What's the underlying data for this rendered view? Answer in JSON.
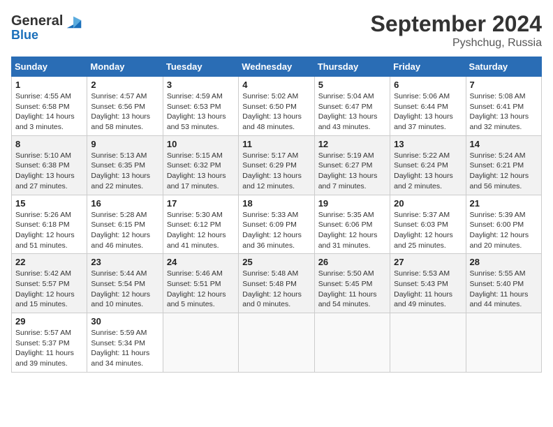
{
  "header": {
    "logo": {
      "general": "General",
      "blue": "Blue"
    },
    "title": "September 2024",
    "location": "Pyshchug, Russia"
  },
  "calendar": {
    "days_of_week": [
      "Sunday",
      "Monday",
      "Tuesday",
      "Wednesday",
      "Thursday",
      "Friday",
      "Saturday"
    ],
    "weeks": [
      [
        {
          "day": "1",
          "sunrise": "4:55 AM",
          "sunset": "6:58 PM",
          "daylight": "14 hours and 3 minutes."
        },
        {
          "day": "2",
          "sunrise": "4:57 AM",
          "sunset": "6:56 PM",
          "daylight": "13 hours and 58 minutes."
        },
        {
          "day": "3",
          "sunrise": "4:59 AM",
          "sunset": "6:53 PM",
          "daylight": "13 hours and 53 minutes."
        },
        {
          "day": "4",
          "sunrise": "5:02 AM",
          "sunset": "6:50 PM",
          "daylight": "13 hours and 48 minutes."
        },
        {
          "day": "5",
          "sunrise": "5:04 AM",
          "sunset": "6:47 PM",
          "daylight": "13 hours and 43 minutes."
        },
        {
          "day": "6",
          "sunrise": "5:06 AM",
          "sunset": "6:44 PM",
          "daylight": "13 hours and 37 minutes."
        },
        {
          "day": "7",
          "sunrise": "5:08 AM",
          "sunset": "6:41 PM",
          "daylight": "13 hours and 32 minutes."
        }
      ],
      [
        {
          "day": "8",
          "sunrise": "5:10 AM",
          "sunset": "6:38 PM",
          "daylight": "13 hours and 27 minutes."
        },
        {
          "day": "9",
          "sunrise": "5:13 AM",
          "sunset": "6:35 PM",
          "daylight": "13 hours and 22 minutes."
        },
        {
          "day": "10",
          "sunrise": "5:15 AM",
          "sunset": "6:32 PM",
          "daylight": "13 hours and 17 minutes."
        },
        {
          "day": "11",
          "sunrise": "5:17 AM",
          "sunset": "6:29 PM",
          "daylight": "13 hours and 12 minutes."
        },
        {
          "day": "12",
          "sunrise": "5:19 AM",
          "sunset": "6:27 PM",
          "daylight": "13 hours and 7 minutes."
        },
        {
          "day": "13",
          "sunrise": "5:22 AM",
          "sunset": "6:24 PM",
          "daylight": "13 hours and 2 minutes."
        },
        {
          "day": "14",
          "sunrise": "5:24 AM",
          "sunset": "6:21 PM",
          "daylight": "12 hours and 56 minutes."
        }
      ],
      [
        {
          "day": "15",
          "sunrise": "5:26 AM",
          "sunset": "6:18 PM",
          "daylight": "12 hours and 51 minutes."
        },
        {
          "day": "16",
          "sunrise": "5:28 AM",
          "sunset": "6:15 PM",
          "daylight": "12 hours and 46 minutes."
        },
        {
          "day": "17",
          "sunrise": "5:30 AM",
          "sunset": "6:12 PM",
          "daylight": "12 hours and 41 minutes."
        },
        {
          "day": "18",
          "sunrise": "5:33 AM",
          "sunset": "6:09 PM",
          "daylight": "12 hours and 36 minutes."
        },
        {
          "day": "19",
          "sunrise": "5:35 AM",
          "sunset": "6:06 PM",
          "daylight": "12 hours and 31 minutes."
        },
        {
          "day": "20",
          "sunrise": "5:37 AM",
          "sunset": "6:03 PM",
          "daylight": "12 hours and 25 minutes."
        },
        {
          "day": "21",
          "sunrise": "5:39 AM",
          "sunset": "6:00 PM",
          "daylight": "12 hours and 20 minutes."
        }
      ],
      [
        {
          "day": "22",
          "sunrise": "5:42 AM",
          "sunset": "5:57 PM",
          "daylight": "12 hours and 15 minutes."
        },
        {
          "day": "23",
          "sunrise": "5:44 AM",
          "sunset": "5:54 PM",
          "daylight": "12 hours and 10 minutes."
        },
        {
          "day": "24",
          "sunrise": "5:46 AM",
          "sunset": "5:51 PM",
          "daylight": "12 hours and 5 minutes."
        },
        {
          "day": "25",
          "sunrise": "5:48 AM",
          "sunset": "5:48 PM",
          "daylight": "12 hours and 0 minutes."
        },
        {
          "day": "26",
          "sunrise": "5:50 AM",
          "sunset": "5:45 PM",
          "daylight": "11 hours and 54 minutes."
        },
        {
          "day": "27",
          "sunrise": "5:53 AM",
          "sunset": "5:43 PM",
          "daylight": "11 hours and 49 minutes."
        },
        {
          "day": "28",
          "sunrise": "5:55 AM",
          "sunset": "5:40 PM",
          "daylight": "11 hours and 44 minutes."
        }
      ],
      [
        {
          "day": "29",
          "sunrise": "5:57 AM",
          "sunset": "5:37 PM",
          "daylight": "11 hours and 39 minutes."
        },
        {
          "day": "30",
          "sunrise": "5:59 AM",
          "sunset": "5:34 PM",
          "daylight": "11 hours and 34 minutes."
        },
        null,
        null,
        null,
        null,
        null
      ]
    ]
  }
}
